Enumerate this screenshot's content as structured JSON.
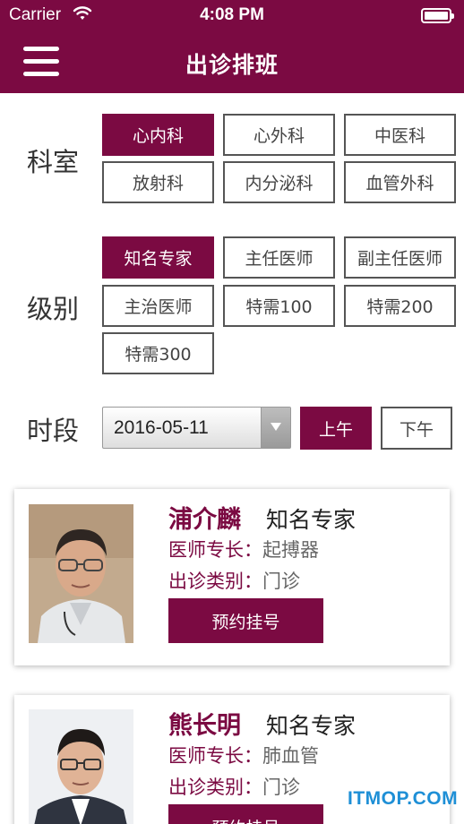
{
  "status_bar": {
    "carrier": "Carrier",
    "time": "4:08 PM",
    "battery_level": 1.0
  },
  "header": {
    "title": "出诊排班",
    "menu_icon": "hamburger-menu-icon"
  },
  "department": {
    "label": "科室",
    "options": [
      "心内科",
      "心外科",
      "中医科",
      "放射科",
      "内分泌科",
      "血管外科"
    ],
    "selected": "心内科"
  },
  "level": {
    "label": "级别",
    "options": [
      "知名专家",
      "主任医师",
      "副主任医师",
      "主治医师",
      "特需100",
      "特需200",
      "特需300"
    ],
    "selected": "知名专家"
  },
  "period": {
    "label": "时段",
    "date": "2016-05-11",
    "options": [
      "上午",
      "下午"
    ],
    "selected": "上午"
  },
  "doctors": [
    {
      "name": "浦介麟",
      "level": "知名专家",
      "specialty_label": "医师专长：",
      "specialty": "起搏器",
      "type_label": "出诊类别：",
      "type": "门诊",
      "book_label": "预约挂号"
    },
    {
      "name": "熊长明",
      "level": "知名专家",
      "specialty_label": "医师专长：",
      "specialty": "肺血管",
      "type_label": "出诊类别：",
      "type": "门诊",
      "book_label": "预约挂号"
    }
  ],
  "watermark": "ITMOP.COM",
  "colors": {
    "brand": "#7b0a42",
    "watermark": "#1e8fd6"
  }
}
